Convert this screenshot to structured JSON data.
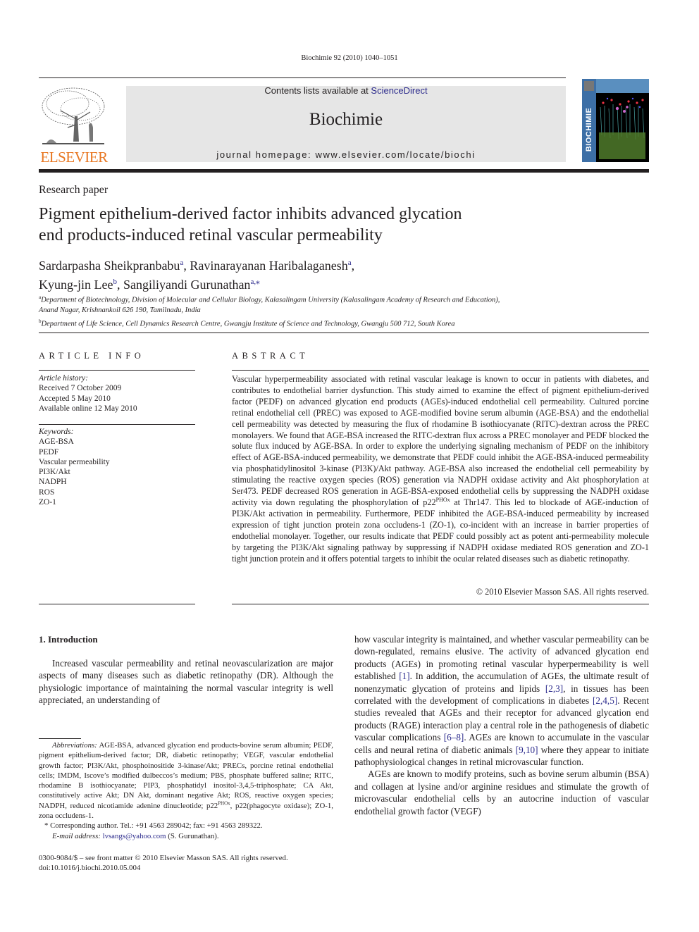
{
  "running_head": "Biochimie 92 (2010) 1040–1051",
  "masthead": {
    "contents_prefix": "Contents lists available at ",
    "contents_link": "ScienceDirect",
    "journal_title": "Biochimie",
    "homepage_prefix": "journal homepage: ",
    "homepage_url": "www.elsevier.com/locate/biochi",
    "publisher_logo_text": "ELSEVIER",
    "cover_label": "BIOCHIMIE",
    "publisher_color": "#e87722",
    "link_color": "#2b2a8c"
  },
  "article": {
    "type": "Research paper",
    "title_line1": "Pigment epithelium-derived factor inhibits advanced glycation",
    "title_line2": "end products-induced retinal vascular permeability",
    "authors": [
      {
        "name": "Sardarpasha Sheikpranbabu",
        "aff": "a",
        "sep": ", "
      },
      {
        "name": "Ravinarayanan Haribalaganesh",
        "aff": "a",
        "sep": ","
      },
      {
        "name": "Kyung-jin Lee",
        "aff": "b",
        "sep": ", "
      },
      {
        "name": "Sangiliyandi Gurunathan",
        "aff": "a,⁎",
        "sep": ""
      }
    ],
    "affiliations": [
      {
        "mark": "a",
        "text": "Department of Biotechnology, Division of Molecular and Cellular Biology, Kalasalingam University (Kalasalingam Academy of Research and Education),",
        "text2": "Anand Nagar, Krishnankoil 626 190, Tamilnadu, India"
      },
      {
        "mark": "b",
        "text": "Department of Life Science, Cell Dynamics Research Centre, Gwangju Institute of Science and Technology, Gwangju 500 712, South Korea",
        "text2": ""
      }
    ]
  },
  "article_info": {
    "heading": "ARTICLE INFO",
    "history_label": "Article history:",
    "history": [
      "Received 7 October 2009",
      "Accepted 5 May 2010",
      "Available online 12 May 2010"
    ],
    "keywords_label": "Keywords:",
    "keywords": [
      "AGE-BSA",
      "PEDF",
      "Vascular permeability",
      "PI3K/Akt",
      "NADPH",
      "ROS",
      "ZO-1"
    ]
  },
  "abstract": {
    "heading": "ABSTRACT",
    "text_before_sup": "Vascular hyperpermeability associated with retinal vascular leakage is known to occur in patients with diabetes, and contributes to endothelial barrier dysfunction. This study aimed to examine the effect of pigment epithelium-derived factor (PEDF) on advanced glycation end products (AGEs)-induced endothelial cell permeability. Cultured porcine retinal endothelial cell (PREC) was exposed to AGE-modified bovine serum albumin (AGE-BSA) and the endothelial cell permeability was detected by measuring the flux of rhodamine B isothiocyanate (RITC)-dextran across the PREC monolayers. We found that AGE-BSA increased the RITC-dextran flux across a PREC monolayer and PEDF blocked the solute flux induced by AGE-BSA. In order to explore the underlying signaling mechanism of PEDF on the inhibitory effect of AGE-BSA-induced permeability, we demonstrate that PEDF could inhibit the AGE-BSA-induced permeability via phosphatidylinositol 3-kinase (PI3K)/Akt pathway. AGE-BSA also increased the endothelial cell permeability by stimulating the reactive oxygen species (ROS) generation via NADPH oxidase activity and Akt phosphorylation at Ser473. PEDF decreased ROS generation in AGE-BSA-exposed endothelial cells by suppressing the NADPH oxidase activity via down regulating the phosphorylation of p22",
    "sup": "PHOx",
    "text_after_sup": " at Thr147. This led to blockade of AGE-induction of PI3K/Akt activation in permeability. Furthermore, PEDF inhibited the AGE-BSA-induced permeability by increased expression of tight junction protein zona occludens-1 (ZO-1), co-incident with an increase in barrier properties of endothelial monolayer. Together, our results indicate that PEDF could possibly act as potent anti-permeability molecule by targeting the PI3K/Akt signaling pathway by suppressing if NADPH oxidase mediated ROS generation and ZO-1 tight junction protein and it offers potential targets to inhibit the ocular related diseases such as diabetic retinopathy.",
    "copyright": "© 2010 Elsevier Masson SAS. All rights reserved."
  },
  "introduction": {
    "heading": "1.  Introduction",
    "left_para": "Increased vascular permeability and retinal neovascularization are major aspects of many diseases such as diabetic retinopathy (DR). Although the physiologic importance of maintaining the normal vascular integrity is well appreciated, an understanding of",
    "right_p1": [
      {
        "t": "how vascular integrity is maintained, and whether vascular permeability can be down-regulated, remains elusive. The activity of advanced glycation end products (AGEs) in promoting retinal vascular hyperpermeability is well established "
      },
      {
        "ref": "[1]"
      },
      {
        "t": ". In addition, the accumulation of AGEs, the ultimate result of nonenzymatic glycation of proteins and lipids "
      },
      {
        "ref": "[2,3]"
      },
      {
        "t": ", in tissues has been correlated with the development of complications in diabetes "
      },
      {
        "ref": "[2,4,5]"
      },
      {
        "t": ". Recent studies revealed that AGEs and their receptor for advanced glycation end products (RAGE) interaction play a central role in the pathogenesis of diabetic vascular complications "
      },
      {
        "ref": "[6–8]"
      },
      {
        "t": ". AGEs are known to accumulate in the vascular cells and neural retina of diabetic animals "
      },
      {
        "ref": "[9,10]"
      },
      {
        "t": " where they appear to initiate pathophysiological changes in retinal microvascular function."
      }
    ],
    "right_p2": "AGEs are known to modify proteins, such as bovine serum albumin (BSA) and collagen at lysine and/or arginine residues and stimulate the growth of microvascular endothelial cells by an autocrine induction of vascular endothelial growth factor (VEGF)"
  },
  "footnotes": {
    "abbrev_label": "Abbreviations:",
    "abbrev_before_sup": " AGE-BSA, advanced glycation end products-bovine serum albumin; PEDF, pigment epithelium-derived factor; DR, diabetic retinopathy; VEGF, vascular endothelial growth factor; PI3K/Akt, phosphoinositide 3-kinase/Akt; PRECs, porcine retinal endothelial cells; IMDM, Iscove’s modified dulbeccos’s medium; PBS, phosphate buffered saline; RITC, rhodamine B isothiocyanate; PIP3, phosphatidyl inositol-3,4,5-triphosphate; CA Akt, constitutively active Akt; DN Akt, dominant negative Akt; ROS, reactive oxygen species; NADPH, reduced nicotiamide adenine dinucleotide; p22",
    "abbrev_sup": "PHOx",
    "abbrev_after_sup": ", p22(phagocyte oxidase); ZO-1, zona occludens-1.",
    "corresponding": "* Corresponding author. Tel.: +91 4563 289042; fax: +91 4563 289322.",
    "email_label": "E-mail address:",
    "email": "lvsangs@yahoo.com",
    "email_suffix": " (S. Gurunathan).",
    "front_matter": "0300-9084/$ – see front matter © 2010 Elsevier Masson SAS. All rights reserved.",
    "doi": "doi:10.1016/j.biochi.2010.05.004"
  }
}
